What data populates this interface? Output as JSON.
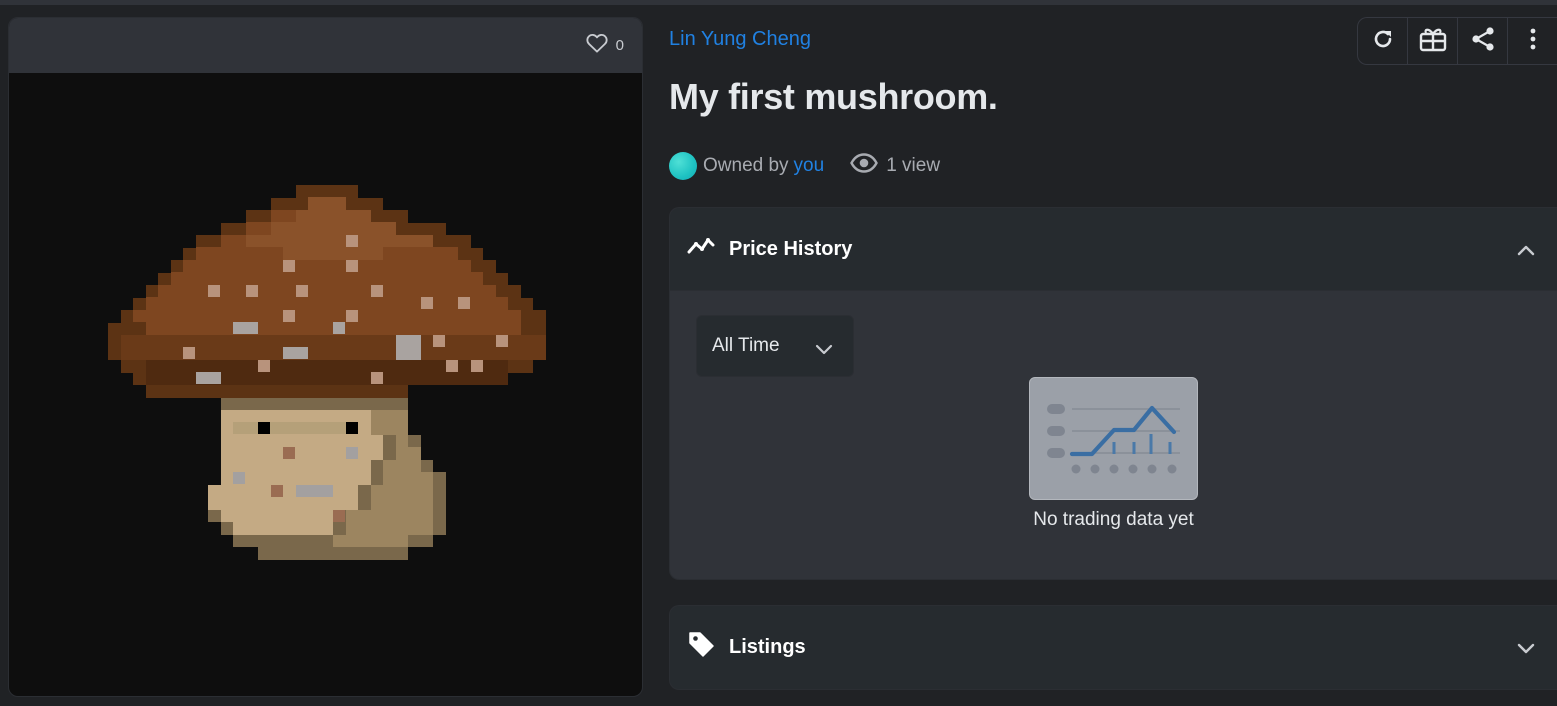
{
  "favorites": {
    "count": "0"
  },
  "item": {
    "creator": "Lin Yung Cheng",
    "title": "My first mushroom.",
    "owned_by_label": "Owned by",
    "owner": "you",
    "views": "1 view"
  },
  "toolbar": {
    "icons": [
      "refresh-icon",
      "gift-icon",
      "share-icon",
      "more-vertical-icon"
    ]
  },
  "price_history": {
    "label": "Price History",
    "range_selected": "All Time",
    "empty_text": "No trading data yet"
  },
  "listings": {
    "label": "Listings"
  },
  "colors": {
    "accent": "#2081e2",
    "background": "#202225",
    "panel": "#262b2f",
    "panel_body": "#303339"
  }
}
